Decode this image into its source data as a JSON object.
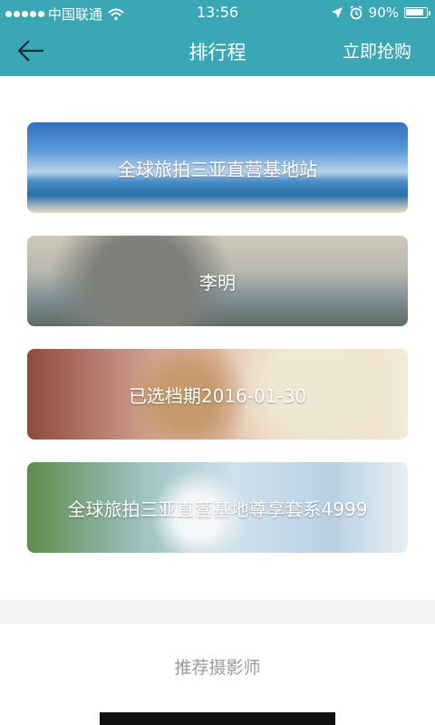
{
  "status": {
    "carrier": "中国联通",
    "time": "13:56",
    "battery_text": "90%",
    "battery_level": 0.9
  },
  "nav": {
    "title": "排行程",
    "action_label": "立即抢购"
  },
  "cards": [
    {
      "label": "全球旅拍三亚直营基地站"
    },
    {
      "label": "李明"
    },
    {
      "label": "已选档期2016-01-30"
    },
    {
      "label": "全球旅拍三亚直营基地尊享套系4999"
    }
  ],
  "recommend": {
    "title": "推荐摄影师"
  },
  "colors": {
    "header": "#3aa7b4",
    "section_divider": "#f3f3f3",
    "section_title": "#9a9a9a"
  }
}
